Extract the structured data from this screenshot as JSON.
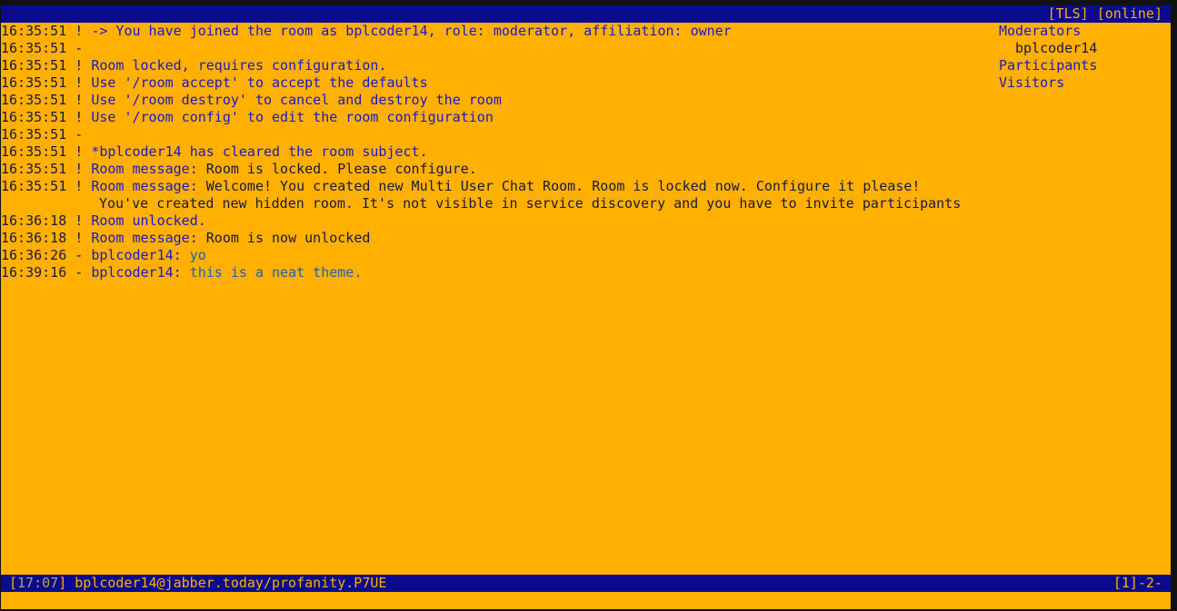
{
  "title_bar": {
    "tls": "[TLS]",
    "status": "[online]"
  },
  "messages": [
    {
      "time": "16:35:51",
      "mark": "!",
      "kind": "sys",
      "text": "-> You have joined the room as bplcoder14, role: moderator, affiliation: owner"
    },
    {
      "time": "16:35:51",
      "mark": "-",
      "kind": "sys",
      "text": ""
    },
    {
      "time": "16:35:51",
      "mark": "!",
      "kind": "sys",
      "text": "Room locked, requires configuration."
    },
    {
      "time": "16:35:51",
      "mark": "!",
      "kind": "sys",
      "text": "Use '/room accept' to accept the defaults"
    },
    {
      "time": "16:35:51",
      "mark": "!",
      "kind": "sys",
      "text": "Use '/room destroy' to cancel and destroy the room"
    },
    {
      "time": "16:35:51",
      "mark": "!",
      "kind": "sys",
      "text": "Use '/room config' to edit the room configuration"
    },
    {
      "time": "16:35:51",
      "mark": "-",
      "kind": "sys",
      "text": ""
    },
    {
      "time": "16:35:51",
      "mark": "!",
      "kind": "sys",
      "text": "*bplcoder14 has cleared the room subject."
    },
    {
      "time": "16:35:51",
      "mark": "!",
      "kind": "roommsg",
      "label": "Room message:",
      "text": " Room is locked. Please configure."
    },
    {
      "time": "16:35:51",
      "mark": "!",
      "kind": "roommsg",
      "label": "Room message:",
      "text": " Welcome! You created new Multi User Chat Room. Room is locked now. Configure it please!"
    },
    {
      "time": "",
      "mark": "",
      "kind": "cont",
      "text": "You've created new hidden room. It's not visible in service discovery and you have to invite participants"
    },
    {
      "time": "16:36:18",
      "mark": "!",
      "kind": "sys",
      "text": "Room unlocked."
    },
    {
      "time": "16:36:18",
      "mark": "!",
      "kind": "roommsg",
      "label": "Room message:",
      "text": " Room is now unlocked"
    },
    {
      "time": "16:36:26",
      "mark": "-",
      "kind": "chat",
      "label": "bplcoder14:",
      "text": " yo"
    },
    {
      "time": "16:39:16",
      "mark": "-",
      "kind": "chat",
      "label": "bplcoder14:",
      "text": " this is a neat theme."
    }
  ],
  "occupants": {
    "moderators_label": "Moderators",
    "moderators": [
      "bplcoder14"
    ],
    "participants_label": "Participants",
    "visitors_label": "Visitors"
  },
  "status_bar": {
    "bracket_open": "[",
    "time": "17:07",
    "bracket_close": "]",
    "account": "bplcoder14@jabber.today/profanity.P7UE",
    "windows_open": "[",
    "active_window": "1",
    "windows_rest": "]-2-"
  }
}
